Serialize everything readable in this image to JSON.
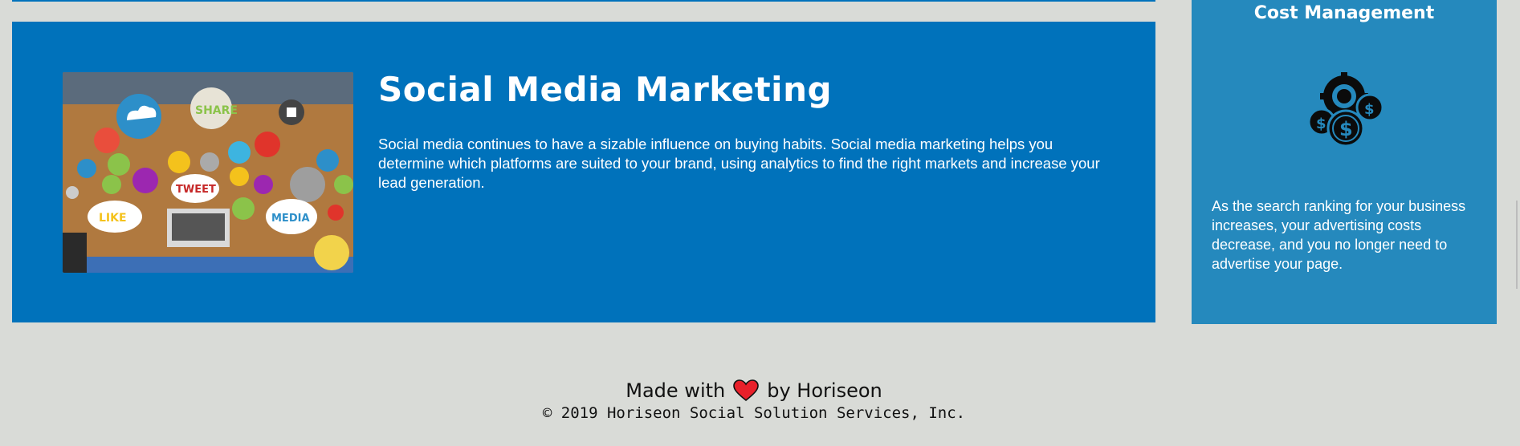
{
  "article": {
    "title": "Social Media Marketing",
    "text": "Social media continues to have a sizable influence on buying habits. Social media marketing helps you determine which platforms are suited to your brand, using analytics to find the right markets and increase your lead generation.",
    "image_labels": {
      "share": "SHARE",
      "tweet": "TWEET",
      "like": "LIKE",
      "media": "MEDIA"
    }
  },
  "sidebar": {
    "title": "Cost Management",
    "text": "As the search ranking for your business increases, your advertising costs decrease, and you no longer need to advertise your page.",
    "icon": "cost-management-icon"
  },
  "footer": {
    "made_prefix": "Made with",
    "made_suffix": "by Horiseon",
    "copyright": "© 2019 Horiseon Social Solution Services, Inc."
  },
  "colors": {
    "page_bg": "#d9dbd7",
    "article_bg": "#0072bb",
    "sidebar_bg": "#2589bd",
    "heart": "#e8202a"
  }
}
